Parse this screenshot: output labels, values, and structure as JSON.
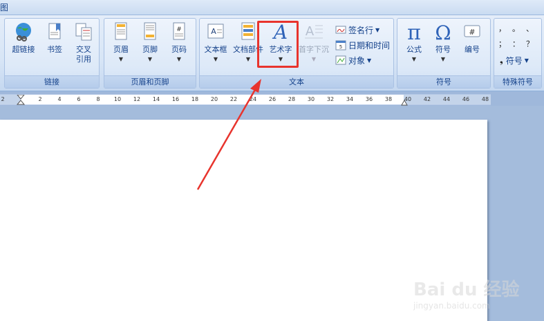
{
  "tabstrip": {
    "label": "图"
  },
  "groups": {
    "links": {
      "label": "链接",
      "buttons": [
        "超链接",
        "书签",
        "交叉引用"
      ]
    },
    "header_footer": {
      "label": "页眉和页脚",
      "buttons": [
        "页眉",
        "页脚",
        "页码"
      ]
    },
    "text": {
      "label": "文本",
      "buttons": [
        "文本框",
        "文档部件",
        "艺术字",
        "首字下沉"
      ],
      "small": [
        "签名行",
        "日期和时间",
        "对象"
      ]
    },
    "symbols": {
      "label": "符号",
      "buttons": [
        "公式",
        "符号",
        "编号"
      ]
    },
    "special": {
      "label": "特殊符号",
      "small": [
        "符号"
      ],
      "glyphs": [
        "，",
        "。",
        "、",
        "；",
        "：",
        "？"
      ]
    }
  },
  "ruler": {
    "ticks": [
      "2",
      "2",
      "4",
      "6",
      "8",
      "10",
      "12",
      "14",
      "16",
      "18",
      "20",
      "22",
      "24",
      "26",
      "28",
      "30",
      "32",
      "34",
      "36",
      "38",
      "40",
      "42",
      "44",
      "46",
      "48"
    ]
  },
  "watermark": {
    "brand": "Bai du 经验",
    "url": "jingyan.baidu.com"
  },
  "colors": {
    "highlight": "#e8342d",
    "ribbon_text": "#15428b"
  }
}
